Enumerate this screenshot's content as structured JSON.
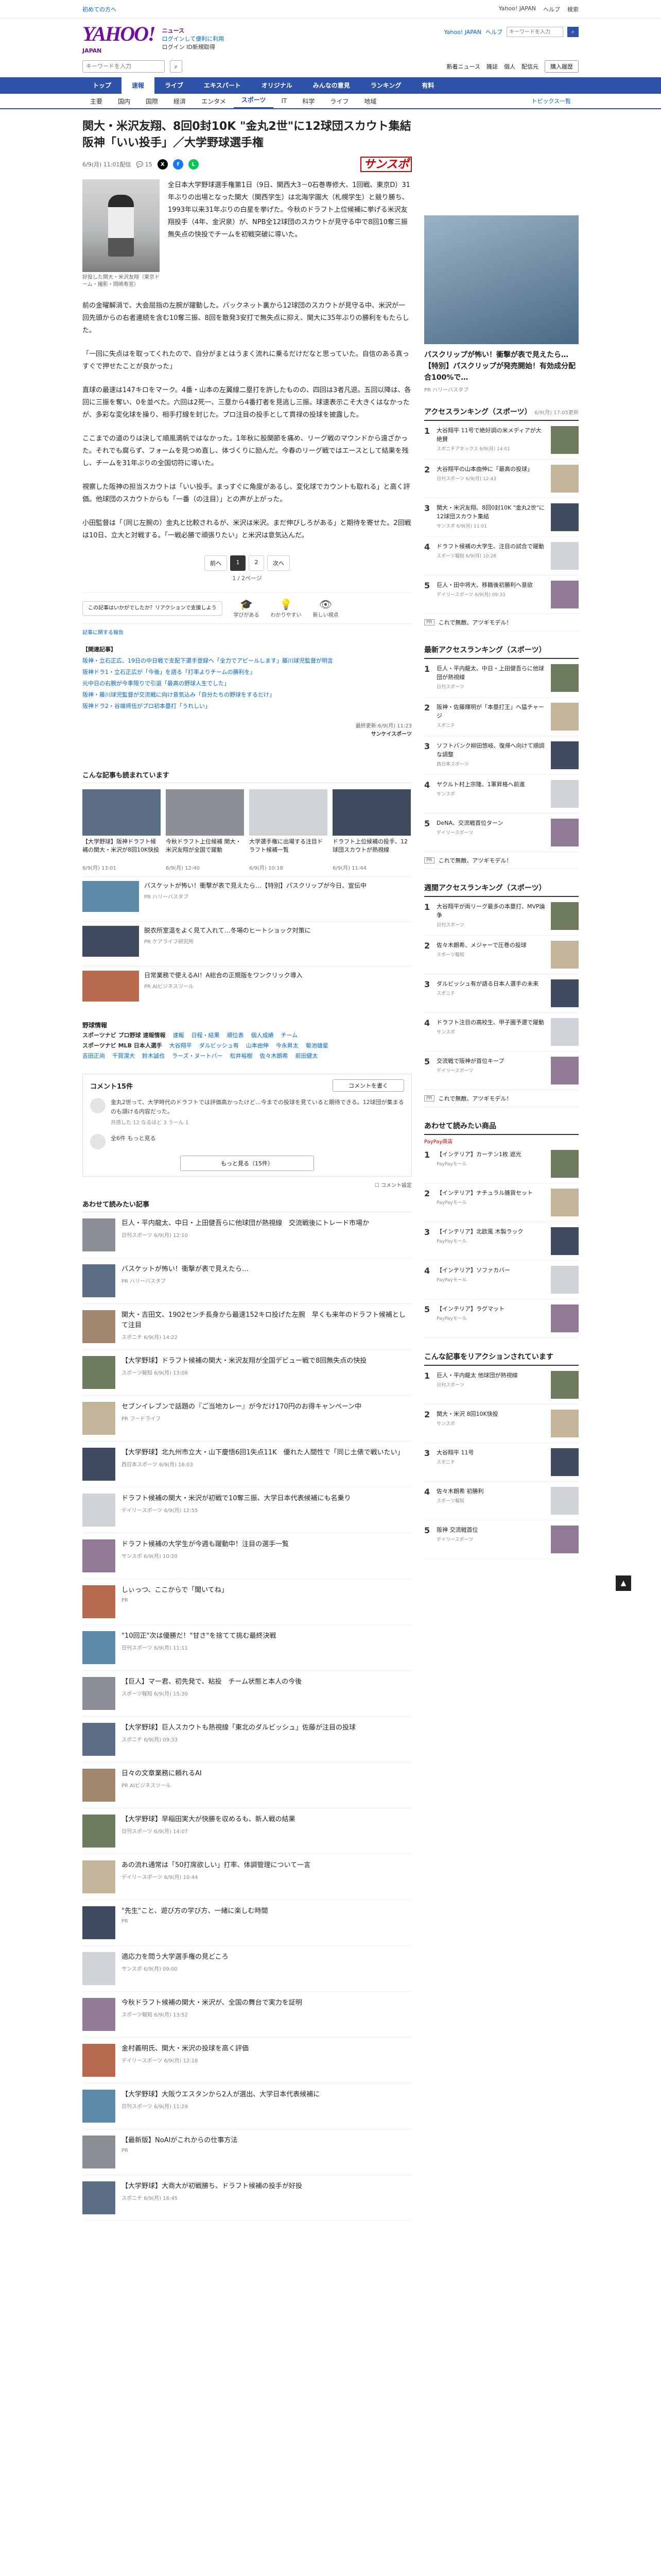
{
  "topbar": {
    "left": "初めての方へ",
    "links": [
      "Yahoo! JAPAN",
      "ヘルプ",
      "検索"
    ]
  },
  "header": {
    "logo": "YAHOO!",
    "logo_sub": "JAPAN",
    "service": "ニュース",
    "links_row1": "ログインして便利に利用",
    "links_row2": "ログイン ID新規取得",
    "right_links": [
      "Yahoo! JAPAN",
      "ヘルプ"
    ],
    "search_placeholder": "キーワードを入力"
  },
  "searchbar": {
    "placeholder": "キーワードを入力",
    "tail_links": [
      "新着ニュース",
      "雑誌",
      "個人",
      "配信元"
    ],
    "button": "購入履歴"
  },
  "nav": {
    "items": [
      "トップ",
      "速報",
      "ライブ",
      "エキスパート",
      "オリジナル",
      "みんなの意見",
      "ランキング",
      "有料"
    ],
    "active": 1
  },
  "subnav": {
    "items": [
      "主要",
      "国内",
      "国際",
      "経済",
      "エンタメ",
      "スポーツ",
      "IT",
      "科学",
      "ライフ",
      "地域"
    ],
    "active": 5,
    "more": "トピックス一覧"
  },
  "article": {
    "title": "関大・米沢友翔、8回0封10K \"金丸2世\"に12球団スカウト集結 阪神「いい投手」／大学野球選手権",
    "date": "6/9(月) 11:01配信",
    "comments": "15",
    "provider": "サンスポ",
    "caption": "好投した関大・米沢友翔（東京ドーム・撮影・岡崎寿宮）",
    "lead": "全日本大学野球選手権第1日（9日、関西大3－0石巻専修大、1回戦、東京D）31年ぶりの出場となった関大（関西学生）は北海学園大（札幌学生）と競り勝ち、1993年以来31年ぶりの白星を挙げた。今秋のドラフト上位候補に挙げる米沢友翔投手（4年、金沢泉）が、NPB全12球団のスカウトが見守る中で8回10奪三振無失点の快投でチームを初戦突破に導いた。",
    "paragraphs": [
      "前の金曜解消で、大会屈指の左腕が躍動した。バックネット裏から12球団のスカウトが見守る中、米沢が一回先頭からの右者連続を含む10奪三振、8回を散発3安打で無失点に抑え、関大に35年ぶりの勝利をもたらした。",
      "「一回に失点はを取ってくれたので、自分がまとはうまく流れに乗るだけだなと思っていた。自信のある真っすぐで押せたことが良かった」",
      "直球の最速は147キロをマーク。4番・山本の左翼線二塁打を許したものの、四回は3者凡退。五回以降は、各回に三振を奪い、0を並べた。六回は2死一、三塁から4番打者を見逃し三振。球速表示こそ大きくはなかったが、多彩な変化球を操り、相手打線を封じた。プロ注目の投手として貫禄の投球を披露した。",
      "ここまでの道のりは決して順風満帆ではなかった。1年秋に股関節を痛め、リーグ戦のマウンドから遠ざかった。それでも腐らず、フォームを見つめ直し、体づくりに励んだ。今春のリーグ戦ではエースとして結果を残し、チームを31年ぶりの全国切符に導いた。",
      "視察した阪神の担当スカウトは「いい投手。まっすぐに角度があるし、変化球でカウントも取れる」と高く評価。他球団のスカウトからも「一番（の注目）」との声が上がった。",
      "小田監督は「（同じ左腕の）金丸と比較されるが、米沢は米沢。まだ伸びしろがある」と期待を寄せた。2回戦は10日、立大と対戦する。「一戦必勝で頑張りたい」と米沢は意気込んだ。"
    ],
    "pager": {
      "prev": "前へ",
      "pages": [
        "1",
        "2"
      ],
      "current": 0,
      "next": "次へ",
      "sub": "1 / 2ページ"
    },
    "reaction_prompt": "この記事はいかがでしたか？リアクションで支援しよう",
    "reactions": [
      "学びがある",
      "わかりやすい",
      "新しい視点"
    ],
    "report": "記事に関する報告",
    "related_heading": "【関連記事】",
    "related": [
      "阪神・立石正広、19日の中日戦で支配下選手登録へ「全力でアピールします」藤川球児監督が明言",
      "阪神ドラ1・立石正広が「今後」を語る「打率よりチームの勝利を」",
      "元中日の右腕が今季限りで引退「最高の野球人生でした」",
      "阪神・藤川球児監督が交流戦に向け意気込み「自分たちの野球をするだけ」",
      "阪神ドラ2・谷端将伍がプロ初本塁打「うれしい」"
    ],
    "footer_date": "最終更新:6/9(月) 11:23",
    "footer_provider": "サンケイスポーツ"
  },
  "recommend": {
    "title": "こんな記事も読まれています",
    "cards": [
      {
        "t": "【大学野球】阪神ドラフト候補の関大・米沢が8回10K快投",
        "m": "6/9(月) 13:01"
      },
      {
        "t": "今秋ドラフト上位候補 関大・米沢友翔が全国で躍動",
        "m": "6/9(月) 12:40"
      },
      {
        "t": "大学選手権に出場する注目ドラフト候補一覧",
        "m": "6/9(月) 10:18"
      },
      {
        "t": "ドラフト上位候補の投手、12球団スカウトが熱視線",
        "m": "6/9(月) 11:44"
      }
    ],
    "ads": [
      {
        "t": "バスケットが怖い！衝撃が表で見えたら…【特別】パスクリップが今日、宣伝中",
        "m": "PR ハリーバスタブ"
      },
      {
        "t": "脱衣所室温をよく見て入れて…冬場のヒートショック対策に",
        "m": "PR ケアライフ研究所"
      },
      {
        "t": "日常業務で使えるAI！A総合の正規版をワンクリック導入",
        "m": "PR AIビジネスツール"
      }
    ]
  },
  "cat_links": {
    "heading": "野球情報",
    "row1_label": "スポーツナビ プロ野球 速報情報",
    "row1": [
      "速報",
      "日程・結果",
      "順位表",
      "個人成績",
      "チーム"
    ],
    "row2_label": "スポーツナビ MLB 日本人選手",
    "row2": [
      "大谷翔平",
      "ダルビッシュ有",
      "山本由伸",
      "今永昇太",
      "菊池雄星"
    ],
    "row3": [
      "吉田正尚",
      "千賀滉大",
      "鈴木誠也",
      "ラーズ・ヌートバー",
      "松井裕樹",
      "佐々木朗希",
      "前田健太"
    ]
  },
  "comments": {
    "title": "コメント15件",
    "button": "コメントを書く",
    "items": [
      {
        "text": "金丸2世って、大学時代のドラフトでは評価高かったけど…今までの投球を見ていると期待できる。12球団が集まるのも頷ける内容だった。",
        "acts": "共感した 12  なるほど 3  うーん 1"
      },
      {
        "text": "全6件 もっと見る",
        "acts": ""
      }
    ],
    "more": "もっと見る（15件）",
    "setting": "コメント設定"
  },
  "also_read": {
    "title": "あわせて読みたい記事",
    "items": [
      {
        "t": "巨人・平内龍太、中日・上田健吾らに他球団が熱視線　交流戦後にトレード市場か",
        "m": "日刊スポーツ 6/9(月) 12:10"
      },
      {
        "t": "バスケットが怖い！衝撃が表で見えたら…",
        "m": "PR ハリーバスタブ"
      },
      {
        "t": "関大・吉田文、1902センチ長身から最速152キロ投げた左腕　早くも来年のドラフト候補として注目",
        "m": "スポニチ 6/9(月) 14:22"
      },
      {
        "t": "【大学野球】ドラフト候補の関大・米沢友翔が全国デビュー戦で8回無失点の快投",
        "m": "スポーツ報知 6/9(月) 13:08"
      },
      {
        "t": "セブンイレブンで話題の『ご当地カレー』が今だけ170円のお得キャンペーン中",
        "m": "PR フードライフ"
      },
      {
        "t": "【大学野球】北九州市立大・山下慶悟6回1失点11K　優れた人間性で「同じ土俵で戦いたい」",
        "m": "西日本スポーツ 6/9(月) 16:03"
      },
      {
        "t": "ドラフト候補の関大・米沢が初戦で10奪三振、大学日本代表候補にも名乗り",
        "m": "デイリースポーツ 6/9(月) 12:55"
      },
      {
        "t": "ドラフト候補の大学生が今週も躍動中！注目の選手一覧",
        "m": "サンスポ 6/9(月) 10:20"
      },
      {
        "t": "しぃっつ、ここからで「聞いてね」",
        "m": "PR"
      },
      {
        "t": "\"10回正\"次は優勝だ！\"甘さ\"を捨てて挑む最終決戦",
        "m": "日刊スポーツ 6/9(月) 11:11"
      },
      {
        "t": "【巨人】マー君、初先発で、粘投　チーム状態と本人の今後",
        "m": "スポーツ報知 6/9(月) 15:30"
      },
      {
        "t": "【大学野球】巨人スカウトも熱視線「東北のダルビッシュ」佐藤が注目の投球",
        "m": "スポニチ 6/9(月) 09:33"
      },
      {
        "t": "日々の文章業務に頼れるAI",
        "m": "PR AIビジネスツール"
      },
      {
        "t": "【大学野球】早稲田実大が快勝を収めるも、新人戦の結果",
        "m": "日刊スポーツ 6/9(月) 14:07"
      },
      {
        "t": "あの流れ通常は「50打席欲しい」打率、体調管理について一言",
        "m": "デイリースポーツ 6/9(月) 10:44"
      },
      {
        "t": "\"先生\"こと、遊び方の学び方、一緒に楽しむ時間",
        "m": "PR"
      },
      {
        "t": "適応力を問う大学選手権の見どころ",
        "m": "サンスポ 6/9(月) 09:00"
      },
      {
        "t": "今秋ドラフト候補の関大・米沢が、全国の舞台で実力を証明",
        "m": "スポーツ報知 6/9(月) 13:52"
      },
      {
        "t": "金村義明氏、関大・米沢の投球を高く評価",
        "m": "デイリースポーツ 6/9(月) 12:18"
      },
      {
        "t": "【大学野球】大阪ウエスタンから2人が選出、大学日本代表候補に",
        "m": "日刊スポーツ 6/9(月) 11:29"
      },
      {
        "t": "【最新版】NoAIがこれからの仕事方法",
        "m": "PR"
      },
      {
        "t": "【大学野球】大商大が初戦勝ち、ドラフト候補の投手が好投",
        "m": "スポニチ 6/9(月) 16:45"
      }
    ]
  },
  "side": {
    "ad_title": "バスクリップが怖い！衝撃が表で見えたら…【特別】パスクリップが発売開始！有効成分配合100%で…",
    "ad_meta": "PR ハリーバスタブ",
    "access_title": "アクセスランキング（スポーツ）",
    "access_sub": "6/9(月) 17:05更新",
    "access": [
      {
        "n": "1",
        "t": "大谷翔平 11号で絶好調の米メディアが大絶賛",
        "m": "スポニチアネックス 6/9(月) 14:01"
      },
      {
        "t": "大谷翔平の山本由伸に「最高の投球」",
        "n": "2",
        "m": "日刊スポーツ 6/9(月) 12:43"
      },
      {
        "n": "3",
        "t": "関大・米沢友翔、8回0封10K \"金丸2世\"に12球団スカウト集結",
        "m": "サンスポ 6/9(月) 11:01"
      },
      {
        "n": "4",
        "t": "ドラフト候補の大学生、注目の試合で躍動",
        "m": "スポーツ報知 6/9(月) 10:28"
      },
      {
        "n": "5",
        "t": "巨人・田中将大、移籍後初勝利へ意欲",
        "m": "デイリースポーツ 6/9(月) 09:33"
      }
    ],
    "pr1": "これで無敵、アツギモデル！",
    "now_title": "最新アクセスランキング（スポーツ）",
    "now": [
      {
        "n": "1",
        "t": "巨人・平内龍太、中日・上田健吾らに他球団が熱視線",
        "m": "日刊スポーツ"
      },
      {
        "n": "2",
        "t": "阪神・佐藤輝明が「本塁打王」へ猛チャージ",
        "m": "スポニチ"
      },
      {
        "n": "3",
        "t": "ソフトバンク柳田悠岐、復帰へ向けて順調な調整",
        "m": "西日本スポーツ"
      },
      {
        "n": "4",
        "t": "ヤクルト村上宗隆、1軍昇格へ前進",
        "m": "サンスポ"
      },
      {
        "n": "5",
        "t": "DeNA、交流戦首位ターン",
        "m": "デイリースポーツ"
      }
    ],
    "pr2": "これで無敵、アツギモデル！",
    "week_title": "週間アクセスランキング（スポーツ）",
    "week": [
      {
        "n": "1",
        "t": "大谷翔平が両リーグ最多の本塁打、MVP論争",
        "m": "日刊スポーツ"
      },
      {
        "n": "2",
        "t": "佐々木朗希、メジャーで圧巻の投球",
        "m": "スポーツ報知"
      },
      {
        "n": "3",
        "t": "ダルビッシュ有が語る日本人選手の未来",
        "m": "スポニチ"
      },
      {
        "n": "4",
        "t": "ドラフト注目の高校生、甲子園予選で躍動",
        "m": "サンスポ"
      },
      {
        "n": "5",
        "t": "交流戦で阪神が首位キープ",
        "m": "デイリースポーツ"
      }
    ],
    "pr3": "これで無敵、アツギモデル！",
    "coupon_title": "あわせて読みたい商品",
    "coupon_sub": "PayPay商店",
    "coupon": [
      {
        "n": "1",
        "t": "【インテリア】カーテン1枚 遮光",
        "m": "PayPayモール"
      },
      {
        "n": "2",
        "t": "【インテリア】ナチュラル雑貨セット",
        "m": "PayPayモール"
      },
      {
        "n": "3",
        "t": "【インテリア】北欧風 木製ラック",
        "m": "PayPayモール"
      },
      {
        "n": "4",
        "t": "【インテリア】ソファカバー",
        "m": "PayPayモール"
      },
      {
        "n": "5",
        "t": "【インテリア】ラグマット",
        "m": "PayPayモール"
      }
    ],
    "reaction_title": "こんな記事をリアクションされています",
    "reaction": [
      {
        "n": "1",
        "t": "巨人・平内龍太 他球団が熱視線",
        "m": "日刊スポーツ"
      },
      {
        "n": "2",
        "t": "関大・米沢 8回10K快投",
        "m": "サンスポ"
      },
      {
        "n": "3",
        "t": "大谷翔平 11号",
        "m": "スポニチ"
      },
      {
        "n": "4",
        "t": "佐々木朗希 初勝利",
        "m": "スポーツ報知"
      },
      {
        "n": "5",
        "t": "阪神 交流戦首位",
        "m": "デイリースポーツ"
      }
    ]
  },
  "scroll_top": "▲"
}
